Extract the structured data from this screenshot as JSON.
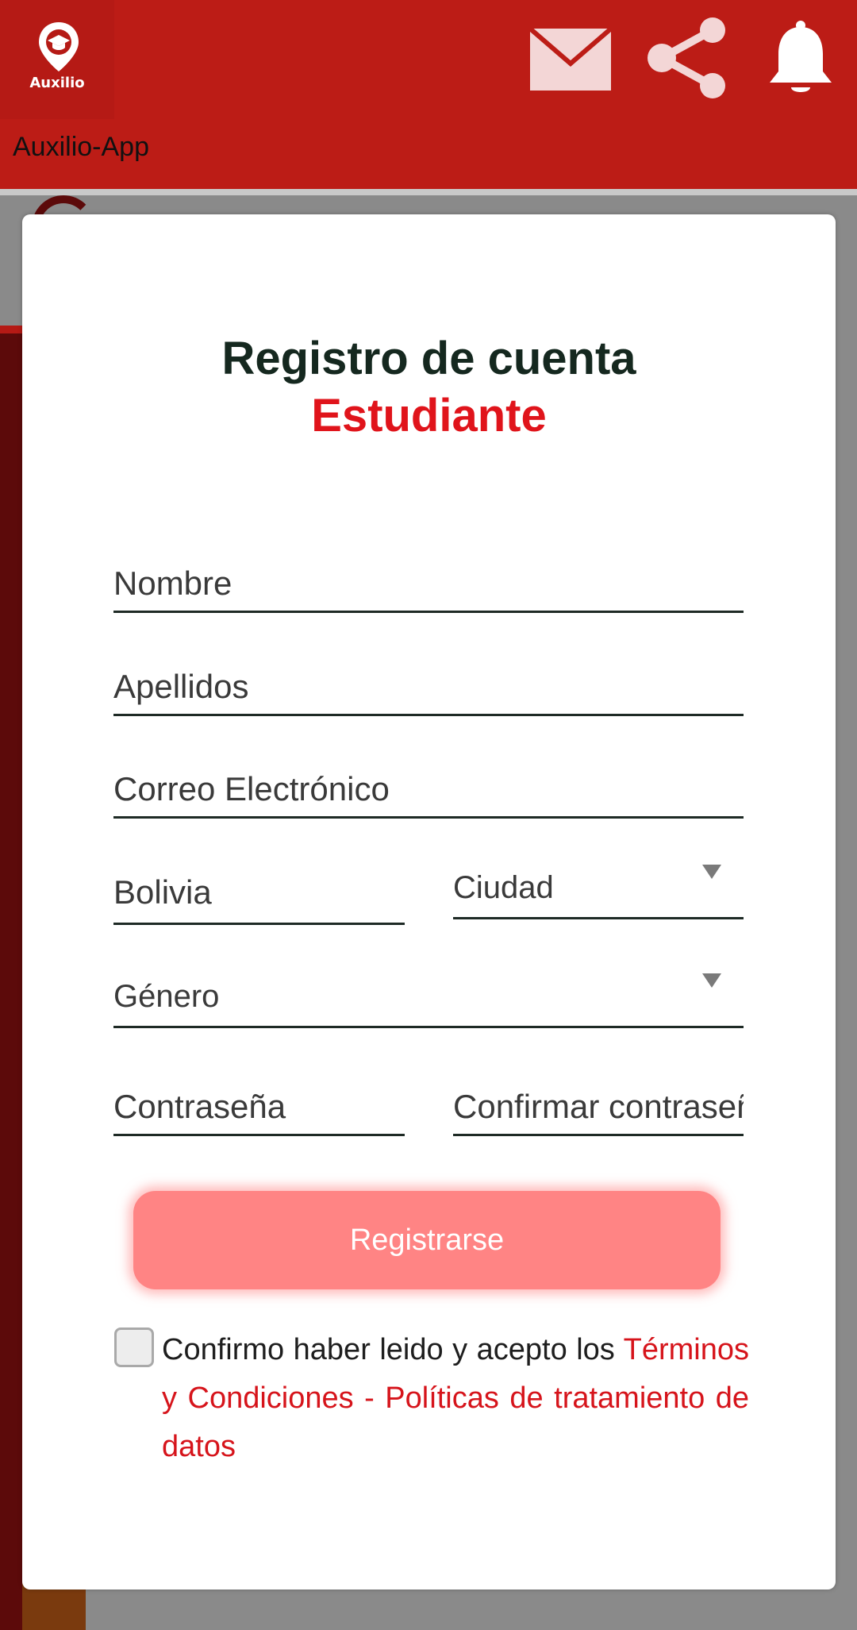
{
  "header": {
    "logo_text": "Auxilio",
    "app_title": "Auxilio-App",
    "icons": [
      "mail-icon",
      "share-icon",
      "bell-icon"
    ]
  },
  "modal": {
    "title": "Registro de cuenta",
    "subtitle": "Estudiante",
    "fields": {
      "nombre_placeholder": "Nombre",
      "apellidos_placeholder": "Apellidos",
      "correo_placeholder": "Correo Electrónico",
      "pais_value": "Bolivia",
      "ciudad_value": "Ciudad",
      "genero_value": "Género",
      "contrasena_placeholder": "Contraseña",
      "confirmar_placeholder": "Confirmar contraseña"
    },
    "register_label": "Registrarse",
    "terms": {
      "prefix": "Confirmo haber leido y acepto los ",
      "link": "Términos y Condiciones - Políticas de tratamiento de datos"
    }
  },
  "colors": {
    "header_red": "#bc1c16",
    "title_dark": "#15281f",
    "accent_red": "#e0141b",
    "button_pink": "#ff8484"
  }
}
